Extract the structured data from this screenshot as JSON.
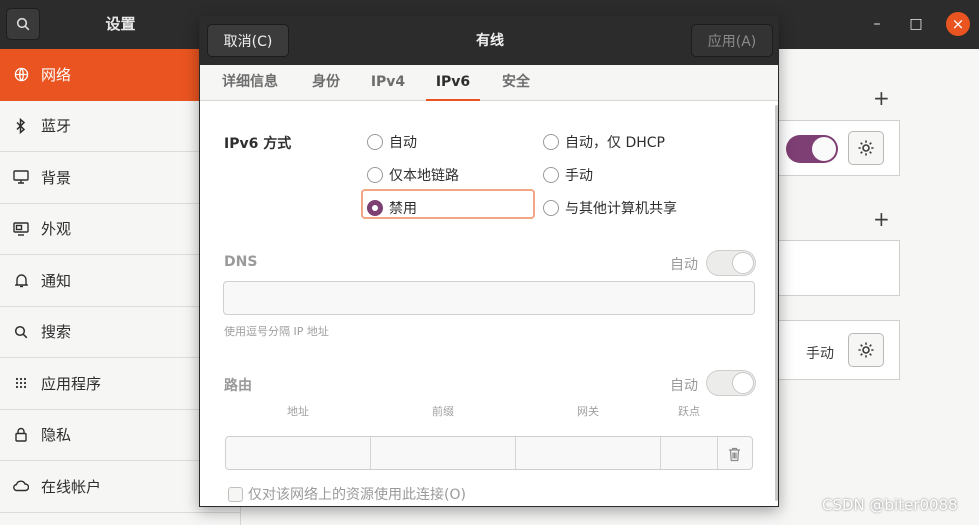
{
  "settings": {
    "title": "设置",
    "window_controls": [
      "–",
      "□",
      "×"
    ]
  },
  "sidebar": {
    "items": [
      {
        "label": "网络",
        "icon": "network-icon",
        "active": true
      },
      {
        "label": "蓝牙",
        "icon": "bluetooth-icon"
      },
      {
        "label": "背景",
        "icon": "background-icon"
      },
      {
        "label": "外观",
        "icon": "appearance-icon"
      },
      {
        "label": "通知",
        "icon": "bell-icon"
      },
      {
        "label": "搜索",
        "icon": "search-icon"
      },
      {
        "label": "应用程序",
        "icon": "apps-grid-icon"
      },
      {
        "label": "隐私",
        "icon": "lock-icon"
      },
      {
        "label": "在线帐户",
        "icon": "cloud-icon"
      }
    ]
  },
  "background_panel": {
    "plus": "+",
    "manual_label": "手动",
    "toggle_on": true
  },
  "dialog": {
    "cancel_label": "取消(C)",
    "title": "有线",
    "apply_label": "应用(A)",
    "tabs": [
      {
        "label": "详细信息"
      },
      {
        "label": "身份"
      },
      {
        "label": "IPv4"
      },
      {
        "label": "IPv6",
        "active": true
      },
      {
        "label": "安全"
      }
    ],
    "ipv6_method_label": "IPv6 方式",
    "methods": [
      {
        "label": "自动",
        "selected": false
      },
      {
        "label": "自动，仅 DHCP",
        "selected": false
      },
      {
        "label": "仅本地链路",
        "selected": false
      },
      {
        "label": "手动",
        "selected": false
      },
      {
        "label": "禁用",
        "selected": true
      },
      {
        "label": "与其他计算机共享",
        "selected": false
      }
    ],
    "dns": {
      "label": "DNS",
      "auto_label": "自动",
      "auto_on": false,
      "value": "",
      "hint": "使用逗号分隔 IP 地址"
    },
    "routes": {
      "label": "路由",
      "auto_label": "自动",
      "auto_on": false,
      "columns": [
        "地址",
        "前缀",
        "网关",
        "跃点"
      ]
    },
    "only_resources_label": "仅对该网络上的资源使用此连接(O)",
    "only_resources_checked": false
  },
  "watermark": "CSDN @biter0088",
  "colors": {
    "accent": "#e95420",
    "radio_selected": "#7e3f74",
    "titlebar": "#2c2c2c"
  }
}
